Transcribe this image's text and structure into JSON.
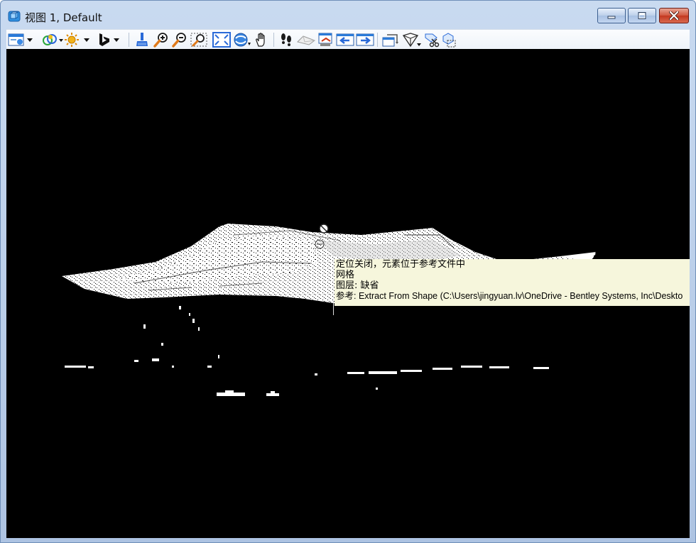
{
  "window": {
    "title": "视图 1, Default",
    "app_icon": "microstation-view-icon",
    "controls": {
      "minimize": "minimize-icon",
      "maximize": "maximize-icon",
      "close": "close-icon"
    }
  },
  "toolbar": {
    "items": [
      {
        "name": "view-attributes",
        "icon": "view-attributes-icon",
        "dropdown": true
      },
      {
        "name": "display-style",
        "icon": "display-style-icon",
        "dropdown": true
      },
      {
        "name": "lighting",
        "icon": "sun-icon",
        "dropdown": true
      },
      {
        "name": "bing-maps",
        "icon": "bing-icon",
        "dropdown": true
      },
      {
        "name": "update-view",
        "icon": "brush-icon"
      },
      {
        "name": "zoom-in",
        "icon": "zoom-in-icon"
      },
      {
        "name": "zoom-out",
        "icon": "zoom-out-icon"
      },
      {
        "name": "window-area",
        "icon": "window-area-icon"
      },
      {
        "name": "fit-view",
        "icon": "fit-view-icon"
      },
      {
        "name": "rotate-view",
        "icon": "rotate-view-icon",
        "dropdown": true
      },
      {
        "name": "pan-view",
        "icon": "hand-icon"
      },
      {
        "name": "walk",
        "icon": "footprints-icon"
      },
      {
        "name": "camera",
        "icon": "camera-icon"
      },
      {
        "name": "copy-view",
        "icon": "copy-view-icon"
      },
      {
        "name": "view-previous",
        "icon": "arrow-left-icon"
      },
      {
        "name": "view-next",
        "icon": "arrow-right-icon"
      },
      {
        "name": "view-clip",
        "icon": "clip-volume-icon"
      },
      {
        "name": "display-mode",
        "icon": "cube-wireframe-icon",
        "dropdown": true
      },
      {
        "name": "clip-element",
        "icon": "scissors-icon"
      },
      {
        "name": "clip-mask",
        "icon": "clip-mask-icon"
      }
    ]
  },
  "viewport": {
    "background": "#000000",
    "content": "point-cloud-terrain"
  },
  "tooltip": {
    "line1": "定位关闭，元素位于参考文件中",
    "line2": "网格",
    "line3": "图层: 缺省",
    "line4": "参考: Extract From Shape (C:\\Users\\jingyuan.lv\\OneDrive - Bentley Systems, Inc\\Deskto",
    "background": "#f6f6dc"
  }
}
